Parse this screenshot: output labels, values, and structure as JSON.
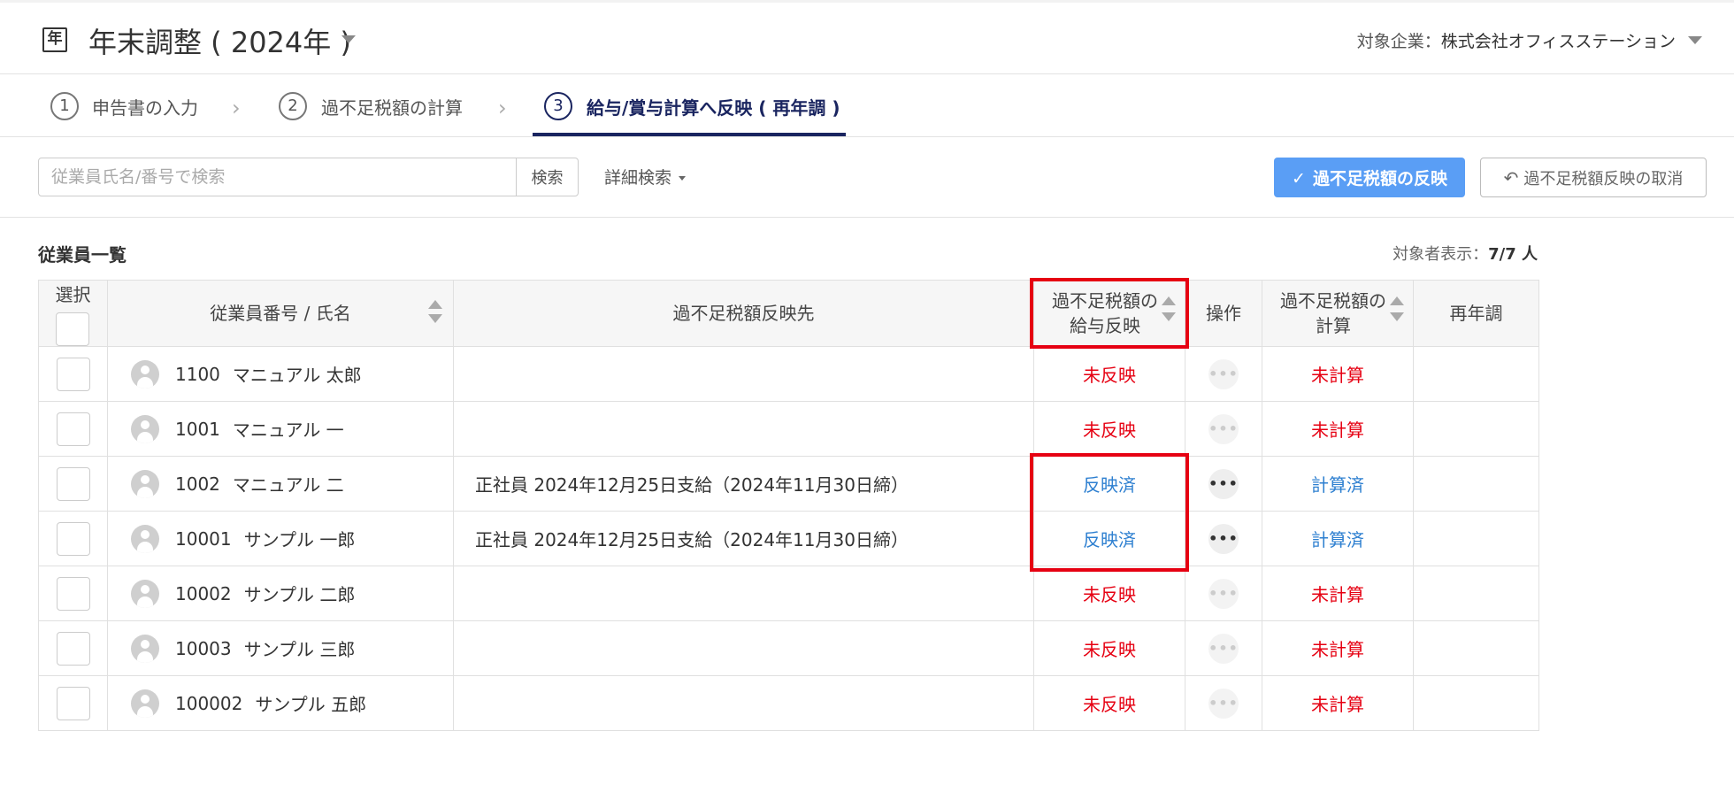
{
  "header": {
    "icon_glyph": "年",
    "title": "年末調整 ( 2024年 )",
    "company_label": "対象企業：",
    "company_name": "株式会社オフィスステーション"
  },
  "steps": [
    {
      "number": "1",
      "label": "申告書の入力"
    },
    {
      "number": "2",
      "label": "過不足税額の計算"
    },
    {
      "number": "3",
      "label": "給与/賞与計算へ反映 ( 再年調 )"
    }
  ],
  "toolbar": {
    "search_placeholder": "従業員氏名/番号で検索",
    "search_button": "検索",
    "advanced_search": "詳細検索",
    "reflect_button": "過不足税額の反映",
    "cancel_button": "過不足税額反映の取消"
  },
  "list": {
    "title": "従業員一覧",
    "count_label": "対象者表示：",
    "count_value": "7/7 人"
  },
  "columns": {
    "select": "選択",
    "employee": "従業員番号 / 氏名",
    "destination": "過不足税額反映先",
    "reflect_line1": "過不足税額の",
    "reflect_line2": "給与反映",
    "operation": "操作",
    "calc_line1": "過不足税額の",
    "calc_line2": "計算",
    "readjust": "再年調"
  },
  "rows": [
    {
      "emp_no": "1100",
      "name": "マニュアル 太郎",
      "destination": "",
      "reflect": "未反映",
      "calc": "未計算",
      "readjust": ""
    },
    {
      "emp_no": "1001",
      "name": "マニュアル 一",
      "destination": "",
      "reflect": "未反映",
      "calc": "未計算",
      "readjust": ""
    },
    {
      "emp_no": "1002",
      "name": "マニュアル 二",
      "destination": "正社員 2024年12月25日支給（2024年11月30日締）",
      "reflect": "反映済",
      "calc": "計算済",
      "readjust": ""
    },
    {
      "emp_no": "10001",
      "name": "サンプル 一郎",
      "destination": "正社員 2024年12月25日支給（2024年11月30日締）",
      "reflect": "反映済",
      "calc": "計算済",
      "readjust": ""
    },
    {
      "emp_no": "10002",
      "name": "サンプル 二郎",
      "destination": "",
      "reflect": "未反映",
      "calc": "未計算",
      "readjust": ""
    },
    {
      "emp_no": "10003",
      "name": "サンプル 三郎",
      "destination": "",
      "reflect": "未反映",
      "calc": "未計算",
      "readjust": ""
    },
    {
      "emp_no": "100002",
      "name": "サンプル 五郎",
      "destination": "",
      "reflect": "未反映",
      "calc": "未計算",
      "readjust": ""
    }
  ],
  "operation_glyph": "•••",
  "colors": {
    "accent_navy": "#1a2560",
    "primary_button": "#5a9ef5",
    "status_red": "#e60012",
    "status_blue": "#2d7fd0",
    "highlight_red": "#e60012"
  }
}
